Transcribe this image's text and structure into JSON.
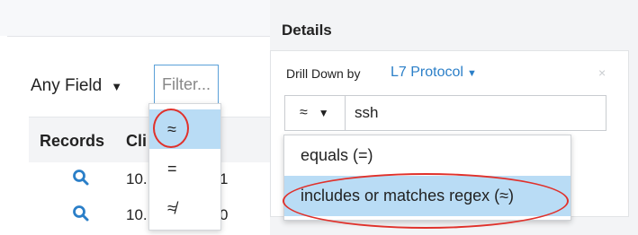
{
  "records_panel": {
    "field_selector": "Any Field",
    "filter_placeholder": "Filter...",
    "headers": [
      "Records",
      "Cli"
    ],
    "rows": [
      {
        "ip": "10.",
        "tail": "1"
      },
      {
        "ip": "10.",
        "tail": "0"
      }
    ],
    "operator_menu": [
      "≈",
      "=",
      "≉"
    ]
  },
  "details": {
    "title": "Details",
    "drill_label": "Drill Down by",
    "drill_field": "L7 Protocol",
    "operator": "≈",
    "value": "ssh",
    "options": [
      "equals (=)",
      "includes or matches regex (≈)"
    ],
    "close": "×"
  },
  "colors": {
    "accent": "#2b7fc8",
    "highlight": "#b9dcf5",
    "annotation": "#e0312b"
  }
}
